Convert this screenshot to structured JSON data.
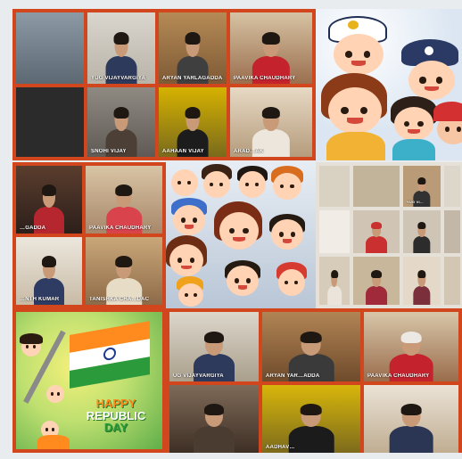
{
  "app": {
    "theme_color": "#d2461d"
  },
  "top_left_panel": {
    "tiles": [
      {
        "name": ""
      },
      {
        "name": "YUG VIJAYVARGIYA"
      },
      {
        "name": "ARYAN YARLAGADDA"
      },
      {
        "name": "PAAVIKA CHAUDHARY"
      },
      {
        "name": ""
      },
      {
        "name": "SNOHI VIJAY"
      },
      {
        "name": "AAHAAN VIJAY"
      },
      {
        "name": "ARAD…AK"
      }
    ]
  },
  "mid_left_panel": {
    "tiles": [
      {
        "name": "…GADDA"
      },
      {
        "name": "PAAVIKA CHAUDHARY"
      },
      {
        "name": "…NTH KUMAR"
      },
      {
        "name": "TANISHKA CHA…DAC"
      }
    ]
  },
  "mid_right_panel": {
    "tiles": [
      {
        "name": ""
      },
      {
        "name": ""
      },
      {
        "name": "YUG VI…"
      },
      {
        "name": ""
      },
      {
        "name": ""
      },
      {
        "name": ""
      },
      {
        "name": ""
      },
      {
        "name": ""
      },
      {
        "name": ""
      },
      {
        "name": ""
      },
      {
        "name": ""
      },
      {
        "name": ""
      }
    ]
  },
  "bottom_left_banner": {
    "line1": "HAPPY",
    "line2": "REPUBLIC",
    "line3": "DAY",
    "colors": {
      "saffron": "#ff8a1e",
      "white": "#ffffff",
      "green": "#2a9a3a",
      "chakra": "#1f3b8f"
    }
  },
  "bottom_right_panel": {
    "tiles": [
      {
        "name": "UG VIJAYVARGIYA"
      },
      {
        "name": "ARYAN YAR…ADDA"
      },
      {
        "name": "PAAVIKA CHAUDHARY"
      },
      {
        "name": ""
      },
      {
        "name": "AADHAV…"
      },
      {
        "name": ""
      }
    ]
  },
  "icons": {
    "mic": "mic-muted-icon",
    "flag": "indian-flag-icon"
  }
}
